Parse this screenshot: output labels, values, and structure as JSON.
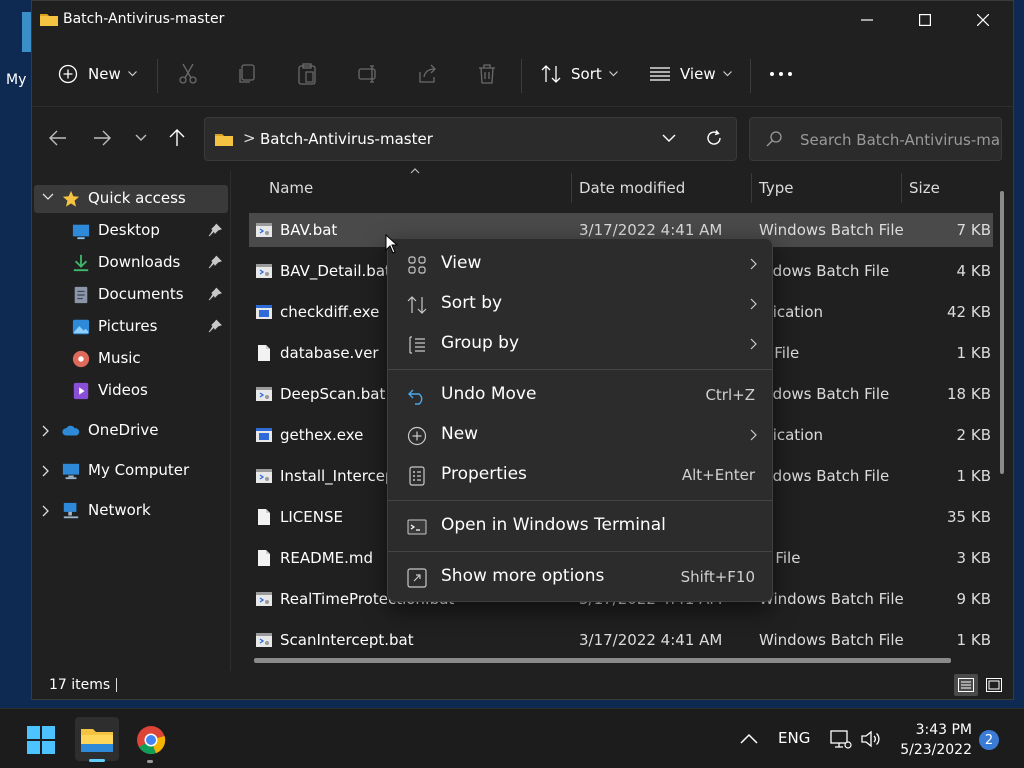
{
  "desktop": {
    "partial_label": "My C"
  },
  "window": {
    "title": "Batch-Antivirus-master",
    "controls": {
      "minimize": "minimize",
      "maximize": "maximize",
      "close": "close"
    }
  },
  "commandbar": {
    "new_label": "New",
    "sort_label": "Sort",
    "view_label": "View",
    "icons": [
      "cut-icon",
      "copy-icon",
      "paste-icon",
      "rename-icon",
      "share-icon",
      "delete-icon",
      "more-icon"
    ]
  },
  "address": {
    "path": "Batch-Antivirus-master",
    "separator": ">",
    "search_placeholder": "Search Batch-Antivirus-master"
  },
  "nav": {
    "quick_access": "Quick access",
    "items": [
      {
        "label": "Desktop",
        "icon": "desktop-icon",
        "pinned": true
      },
      {
        "label": "Downloads",
        "icon": "downloads-icon",
        "pinned": true
      },
      {
        "label": "Documents",
        "icon": "documents-icon",
        "pinned": true
      },
      {
        "label": "Pictures",
        "icon": "pictures-icon",
        "pinned": true
      },
      {
        "label": "Music",
        "icon": "music-icon",
        "pinned": false
      },
      {
        "label": "Videos",
        "icon": "videos-icon",
        "pinned": false
      }
    ],
    "roots": [
      {
        "label": "OneDrive",
        "icon": "onedrive-icon"
      },
      {
        "label": "My Computer",
        "icon": "computer-icon"
      },
      {
        "label": "Network",
        "icon": "network-icon"
      }
    ]
  },
  "columns": {
    "name": "Name",
    "date": "Date modified",
    "type": "Type",
    "size": "Size"
  },
  "files": [
    {
      "name": "BAV.bat",
      "date": "3/17/2022 4:41 AM",
      "type": "Windows Batch File",
      "size": "7 KB",
      "icon": "batch-file-icon",
      "selected": true
    },
    {
      "name": "BAV_Detail.bat",
      "date": "",
      "type": "indows Batch File",
      "size": "4 KB",
      "icon": "batch-file-icon"
    },
    {
      "name": "checkdiff.exe",
      "date": "",
      "type": "plication",
      "size": "42 KB",
      "icon": "exe-icon"
    },
    {
      "name": "database.ver",
      "date": "",
      "type": "R File",
      "size": "1 KB",
      "icon": "file-icon"
    },
    {
      "name": "DeepScan.bat",
      "date": "",
      "type": "indows Batch File",
      "size": "18 KB",
      "icon": "batch-file-icon"
    },
    {
      "name": "gethex.exe",
      "date": "",
      "type": "plication",
      "size": "2 KB",
      "icon": "exe-icon"
    },
    {
      "name": "Install_Intercept.",
      "date": "",
      "type": "indows Batch File",
      "size": "1 KB",
      "icon": "batch-file-icon"
    },
    {
      "name": "LICENSE",
      "date": "",
      "type": "",
      "size": "35 KB",
      "icon": "file-icon"
    },
    {
      "name": "README.md",
      "date": "",
      "type": "D File",
      "size": "3 KB",
      "icon": "file-icon"
    },
    {
      "name": "RealTimeProtection.bat",
      "date": "3/17/2022 4:41 AM",
      "type": "Windows Batch File",
      "size": "9 KB",
      "icon": "batch-file-icon"
    },
    {
      "name": "ScanIntercept.bat",
      "date": "3/17/2022 4:41 AM",
      "type": "Windows Batch File",
      "size": "1 KB",
      "icon": "batch-file-icon"
    }
  ],
  "status": {
    "item_count": "17 items"
  },
  "context_menu": {
    "items": [
      {
        "label": "View",
        "icon": "grid-icon",
        "submenu": true
      },
      {
        "label": "Sort by",
        "icon": "sort-icon",
        "submenu": true
      },
      {
        "label": "Group by",
        "icon": "group-icon",
        "submenu": true
      },
      {
        "label": "Undo Move",
        "icon": "undo-icon",
        "shortcut": "Ctrl+Z"
      },
      {
        "label": "New",
        "icon": "new-icon",
        "submenu": true
      },
      {
        "label": "Properties",
        "icon": "properties-icon",
        "shortcut": "Alt+Enter"
      },
      {
        "label": "Open in Windows Terminal",
        "icon": "terminal-icon"
      },
      {
        "label": "Show more options",
        "icon": "more-options-icon",
        "shortcut": "Shift+F10"
      }
    ]
  },
  "taskbar": {
    "apps": [
      "start-icon",
      "file-explorer-icon",
      "chrome-icon"
    ],
    "language": "ENG",
    "time": "3:43 PM",
    "date": "5/23/2022",
    "notification_count": "2"
  },
  "colors": {
    "accent": "#60cdff",
    "window_bg": "#202020",
    "menu_bg": "#2c2c2c",
    "folder": "#f5c342"
  }
}
